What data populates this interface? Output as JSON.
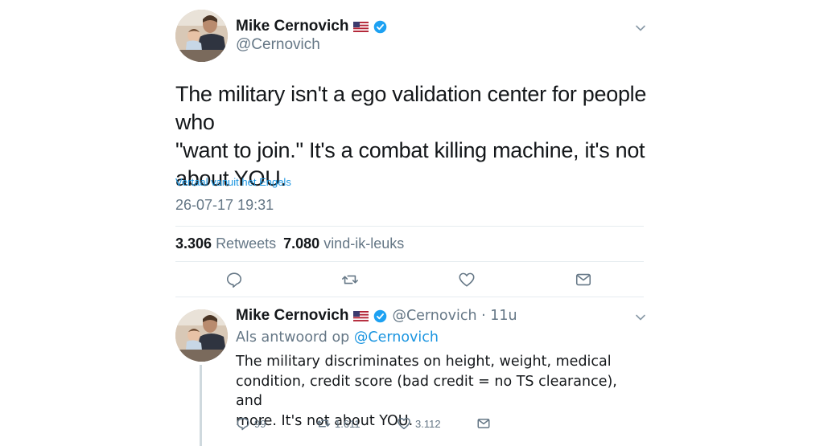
{
  "main_tweet": {
    "display_name": "Mike Cernovich",
    "handle": "@Cernovich",
    "text_line1": "The military isn't a ego validation center for people who",
    "text_line2": "\"want to join.\" It's a combat killing machine, it's not",
    "text_line3": "about YOU.",
    "translate_label": "Vertaal vanuit het Engels",
    "timestamp": "26-07-17 19:31",
    "retweets_count": "3.306",
    "retweets_label": "Retweets",
    "likes_count": "7.080",
    "likes_label": "vind-ik-leuks",
    "icons": {
      "flag": "us-flag-icon",
      "verified": "verified-badge-icon",
      "menu": "chevron-down-icon",
      "reply": "reply-icon",
      "retweet": "retweet-icon",
      "like": "heart-icon",
      "dm": "envelope-icon"
    }
  },
  "reply_tweet": {
    "display_name": "Mike Cernovich",
    "handle_time": "@Cernovich · 11u",
    "replying_prefix": "Als antwoord op",
    "replying_mention": "@Cernovich",
    "text_line1": "The military discriminates on height, weight, medical",
    "text_line2": "condition, credit score (bad credit = no TS clearance), and",
    "text_line3": "more. It's not about YOU.",
    "reply_count": "99",
    "retweet_count": "1.611",
    "like_count": "3.112"
  },
  "colors": {
    "text": "#14171a",
    "secondary": "#657786",
    "link": "#1b95e0",
    "verified": "#1da1f2",
    "divider": "#e6ecf0"
  }
}
